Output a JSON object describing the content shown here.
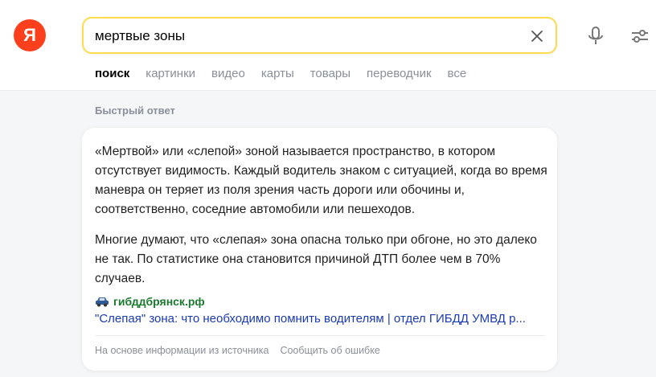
{
  "logo": {
    "letter": "Я",
    "color": "#fc3f1d"
  },
  "search": {
    "value": "мертвые зоны",
    "border_color": "#ffdb4d",
    "clear_icon": "close-icon",
    "mic_icon": "microphone-icon",
    "filter_icon": "sliders-icon"
  },
  "tabs": [
    {
      "label": "поиск",
      "active": true
    },
    {
      "label": "картинки",
      "active": false
    },
    {
      "label": "видео",
      "active": false
    },
    {
      "label": "карты",
      "active": false
    },
    {
      "label": "товары",
      "active": false
    },
    {
      "label": "переводчик",
      "active": false
    },
    {
      "label": "все",
      "active": false
    }
  ],
  "quick_answer": {
    "title": "Быстрый ответ",
    "paragraphs": [
      "«Мертвой» или «слепой» зоной называется пространство, в котором отсутствует видимость. Каждый водитель знаком с ситуацией, когда во время маневра он теряет из поля зрения часть дороги или обочины и, соответственно, соседние автомобили или пешеходов.",
      "Многие думают, что «слепая» зона опасна только при обгоне, но это далеко не так. По статистике она становится причиной ДТП более чем в 70% случаев."
    ],
    "source": {
      "domain": "гибддбрянск.рф",
      "icon": "car-icon",
      "title": "\"Слепая\" зона: что необходимо помнить водителям | отдел ГИБДД УМВД р..."
    },
    "footer": {
      "based_on": "На основе информации из источника",
      "report": "Сообщить об ошибке"
    }
  }
}
